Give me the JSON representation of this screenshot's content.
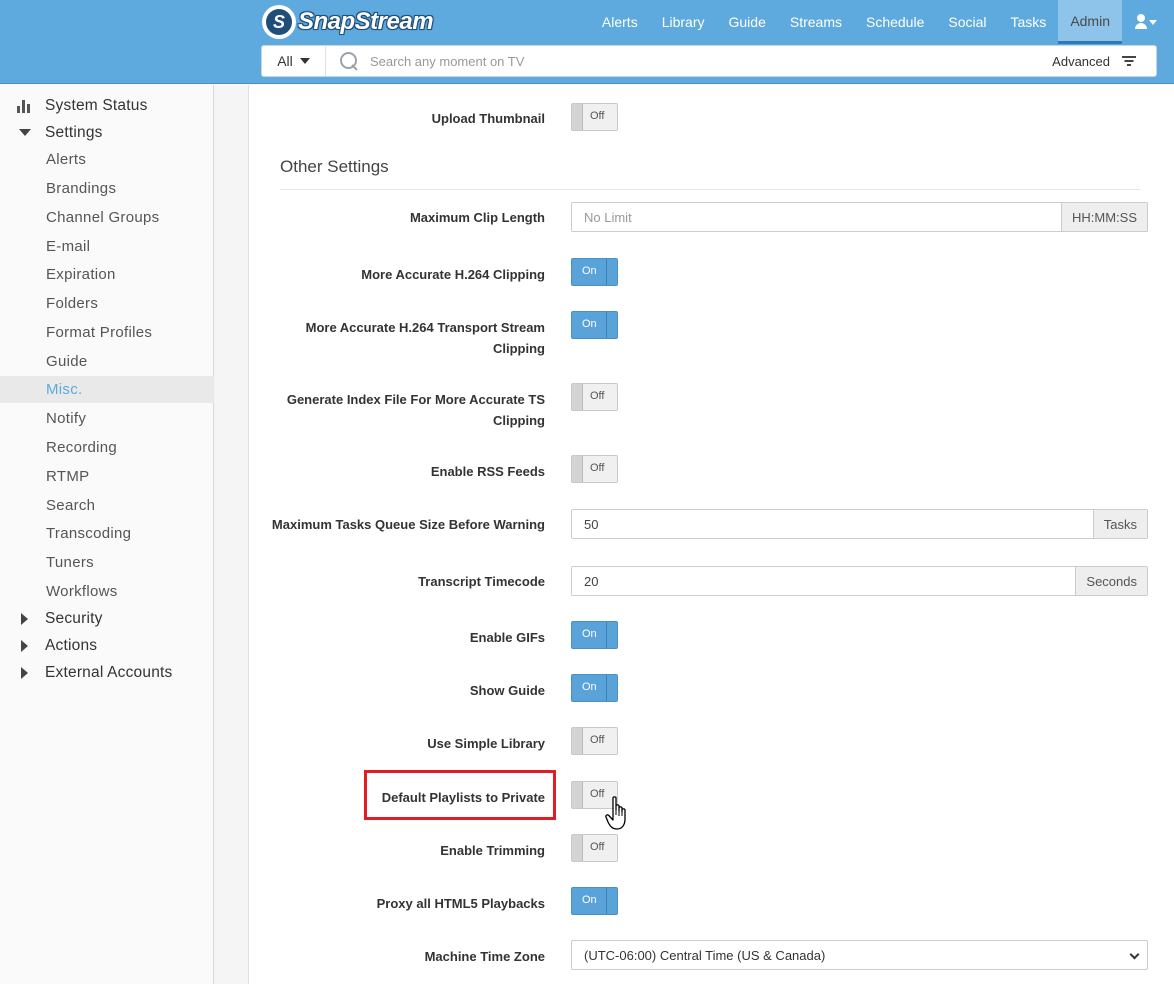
{
  "header": {
    "logo_letter": "S",
    "logo_text": "SnapStream",
    "nav": [
      "Alerts",
      "Library",
      "Guide",
      "Streams",
      "Schedule",
      "Social",
      "Tasks",
      "Admin"
    ],
    "active_nav": "Admin"
  },
  "search": {
    "scope": "All",
    "placeholder": "Search any moment on TV",
    "advanced_label": "Advanced"
  },
  "sidebar": {
    "system_status": "System Status",
    "settings": "Settings",
    "settings_items": [
      "Alerts",
      "Brandings",
      "Channel Groups",
      "E-mail",
      "Expiration",
      "Folders",
      "Format Profiles",
      "Guide",
      "Misc.",
      "Notify",
      "Recording",
      "RTMP",
      "Search",
      "Transcoding",
      "Tuners",
      "Workflows"
    ],
    "active_item": "Misc.",
    "security": "Security",
    "actions": "Actions",
    "external_accounts": "External Accounts"
  },
  "main": {
    "upload_thumbnail": {
      "label": "Upload Thumbnail",
      "state": "Off"
    },
    "section_title": "Other Settings",
    "max_clip_length": {
      "label": "Maximum Clip Length",
      "placeholder": "No Limit",
      "addon": "HH:MM:SS"
    },
    "accurate_h264": {
      "label": "More Accurate H.264 Clipping",
      "state": "On"
    },
    "accurate_h264_ts": {
      "label": "More Accurate H.264 Transport Stream Clipping",
      "state": "On"
    },
    "index_file": {
      "label": "Generate Index File For More Accurate TS Clipping",
      "state": "Off"
    },
    "rss_feeds": {
      "label": "Enable RSS Feeds",
      "state": "Off"
    },
    "max_tasks": {
      "label": "Maximum Tasks Queue Size Before Warning",
      "value": "50",
      "addon": "Tasks"
    },
    "transcript_timecode": {
      "label": "Transcript Timecode",
      "value": "20",
      "addon": "Seconds"
    },
    "enable_gifs": {
      "label": "Enable GIFs",
      "state": "On"
    },
    "show_guide": {
      "label": "Show Guide",
      "state": "On"
    },
    "simple_library": {
      "label": "Use Simple Library",
      "state": "Off"
    },
    "private_playlists": {
      "label": "Default Playlists to Private",
      "state": "Off"
    },
    "enable_trimming": {
      "label": "Enable Trimming",
      "state": "Off"
    },
    "proxy_html5": {
      "label": "Proxy all HTML5 Playbacks",
      "state": "On"
    },
    "time_zone": {
      "label": "Machine Time Zone",
      "value": "(UTC-06:00) Central Time (US & Canada)"
    }
  },
  "colors": {
    "header_blue": "#5ea9dd",
    "toggle_on": "#5aa3d8",
    "highlight_red": "#e31b23"
  }
}
